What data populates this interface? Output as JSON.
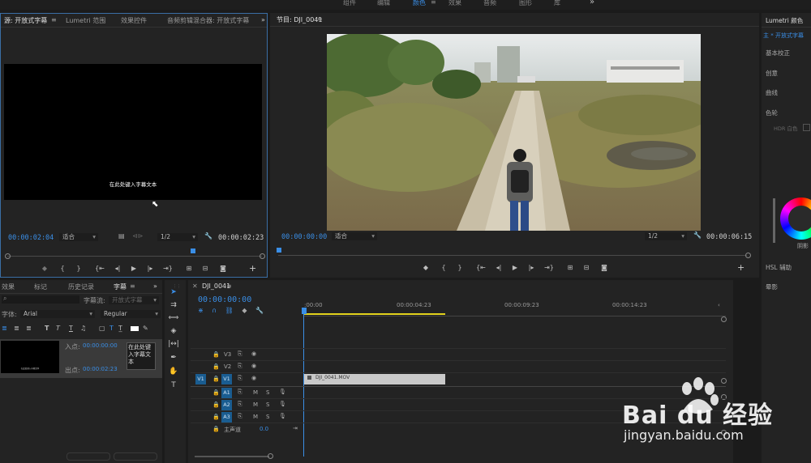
{
  "workspace_tabs": [
    "组件",
    "编辑",
    "颜色",
    "效果",
    "音频",
    "图形",
    "库"
  ],
  "workspace_active": "颜色",
  "workspace_overflow": "»",
  "source_panel": {
    "tabs": [
      "源: 开放式字幕",
      "Lumetri 范围",
      "效果控件",
      "音频剪辑混合器: 开放式字幕"
    ],
    "caption_text": "在此处键入字幕文本",
    "timecode_current": "00:00:02:04",
    "fit": "适合",
    "resolution": "1/2",
    "timecode_duration": "00:00:02:23"
  },
  "program_panel": {
    "title": "节目: DJI_0041",
    "timecode_current": "00:00:00:00",
    "fit": "适合",
    "resolution": "1/2",
    "timecode_duration": "00:00:06:15"
  },
  "lumetri_panel": {
    "title": "Lumetri 颜色",
    "subtitle": "主 * 开放式字幕",
    "sections": [
      "基本校正",
      "创意",
      "曲线",
      "色轮"
    ],
    "hdr_label": "HDR 白色",
    "shadow_label": "阴影",
    "hsl_label": "HSL 辅助",
    "vignette_label": "晕影"
  },
  "captions_panel": {
    "tabs": [
      "效果",
      "标记",
      "历史记录",
      "字幕"
    ],
    "active_tab": "字幕",
    "search_placeholder": "",
    "stream_label": "字幕流:",
    "stream_value": "开放式字幕",
    "font_label": "字体:",
    "font_value": "Arial",
    "style_value": "Regular",
    "in_label": "入点:",
    "in_value": "00:00:00:00",
    "out_label": "出点:",
    "out_value": "00:00:02:23",
    "caption_text": "在此处键入字幕文本",
    "thumb_caption": "在此处键入字幕文本"
  },
  "timeline_panel": {
    "title": "DJI_0041",
    "timecode": "00:00:00:00",
    "ruler_labels": [
      ":00:00",
      "00:00:04:23",
      "00:00:09:23",
      "00:00:14:23"
    ],
    "video_tracks": [
      "V3",
      "V2",
      "V1"
    ],
    "audio_tracks": [
      "A1",
      "A2",
      "A3"
    ],
    "source_patch": "V1",
    "master_label": "主声道",
    "master_value": "0.0",
    "clip_name": "DJI_0041.MOV"
  },
  "watermark": {
    "brand": "Bai du 经验",
    "url": "jingyan.baidu.com"
  }
}
